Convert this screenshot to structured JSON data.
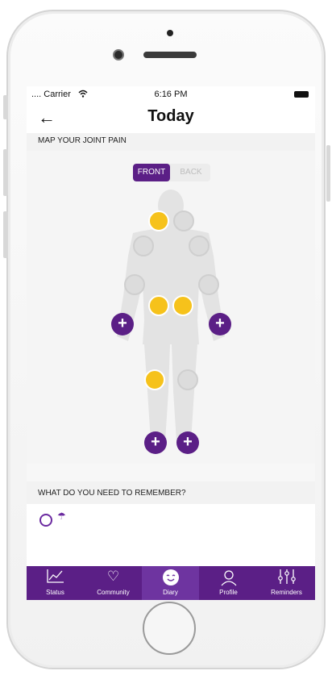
{
  "status_bar": {
    "carrier": ".... Carrier",
    "time": "6:16 PM"
  },
  "nav": {
    "back_icon": "back-arrow-icon",
    "title": "Today"
  },
  "joint_map": {
    "header": "MAP YOUR JOINT PAIN",
    "toggle": {
      "front_label": "FRONT",
      "back_label": "BACK",
      "selected": "FRONT"
    },
    "add_marker": "+",
    "selected_color": "#f6c21b",
    "unselected_color": "#dcdcdc",
    "accent_color": "#5b1f86"
  },
  "remember": {
    "header": "WHAT DO YOU NEED TO REMEMBER?",
    "icons": [
      "circle-q-icon",
      "umbrella-icon"
    ]
  },
  "tabbar": {
    "tabs": [
      {
        "label": "Status",
        "icon": "chart-icon"
      },
      {
        "label": "Community",
        "icon": "handshake-heart-icon"
      },
      {
        "label": "Diary",
        "icon": "smiley-icon",
        "active": true
      },
      {
        "label": "Profile",
        "icon": "person-icon"
      },
      {
        "label": "Reminders",
        "icon": "sliders-icon"
      }
    ]
  }
}
